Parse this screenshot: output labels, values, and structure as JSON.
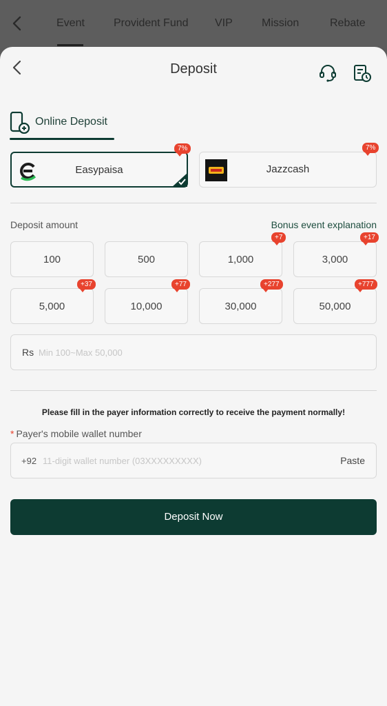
{
  "top_tabs": [
    "Event",
    "Provident Fund",
    "VIP",
    "Mission",
    "Rebate"
  ],
  "header": {
    "title": "Deposit"
  },
  "method_tab": {
    "label": "Online Deposit"
  },
  "channels": [
    {
      "name": "Easypaisa",
      "bonus": "7%",
      "selected": true
    },
    {
      "name": "Jazzcash",
      "bonus": "7%",
      "selected": false
    }
  ],
  "amount_section": {
    "label": "Deposit amount",
    "bonus_link": "Bonus event explanation"
  },
  "amounts": [
    {
      "value": "100",
      "bonus": ""
    },
    {
      "value": "500",
      "bonus": ""
    },
    {
      "value": "1,000",
      "bonus": "+7"
    },
    {
      "value": "3,000",
      "bonus": "+17"
    },
    {
      "value": "5,000",
      "bonus": "+37"
    },
    {
      "value": "10,000",
      "bonus": "+77"
    },
    {
      "value": "30,000",
      "bonus": "+277"
    },
    {
      "value": "50,000",
      "bonus": "+777"
    }
  ],
  "amount_input": {
    "prefix": "Rs",
    "placeholder": "Min 100~Max 50,000"
  },
  "notice": "Please fill in the payer information correctly to receive the payment normally!",
  "wallet": {
    "label": "Payer's mobile wallet number",
    "prefix": "+92",
    "placeholder": "11-digit wallet number (03XXXXXXXXX)",
    "paste_label": "Paste"
  },
  "submit_label": "Deposit Now",
  "colors": {
    "primary": "#0d3b32",
    "badge": "#e8432e",
    "background": "#f5f5f5"
  },
  "icons": [
    "back-icon",
    "headset-icon",
    "history-icon",
    "phone-icon",
    "checkmark-icon"
  ]
}
